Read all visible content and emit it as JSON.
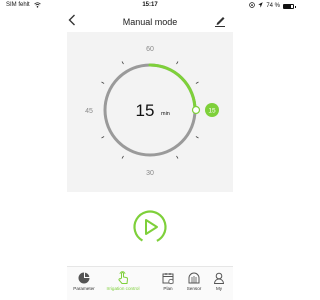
{
  "status": {
    "carrier": "SIM fehlt",
    "time": "15:17",
    "battery_text": "74 %",
    "battery_level": 0.74
  },
  "nav": {
    "title": "Manual mode"
  },
  "dial": {
    "value": "15",
    "unit": "min",
    "tick_labels": {
      "top": "60",
      "left": "45",
      "bottom": "30"
    },
    "handle_value": "15",
    "progress_fraction": 0.25,
    "accent": "#7ed03a",
    "track": "#9a9a9a"
  },
  "tabs": [
    {
      "label": "Parameter",
      "icon": "pie-chart-icon"
    },
    {
      "label": "Irrigation control",
      "icon": "hand-touch-icon",
      "active": true
    },
    {
      "label": "Plan",
      "icon": "calendar-icon"
    },
    {
      "label": "Sensor",
      "icon": "sensor-icon"
    },
    {
      "label": "My",
      "icon": "person-icon"
    }
  ]
}
